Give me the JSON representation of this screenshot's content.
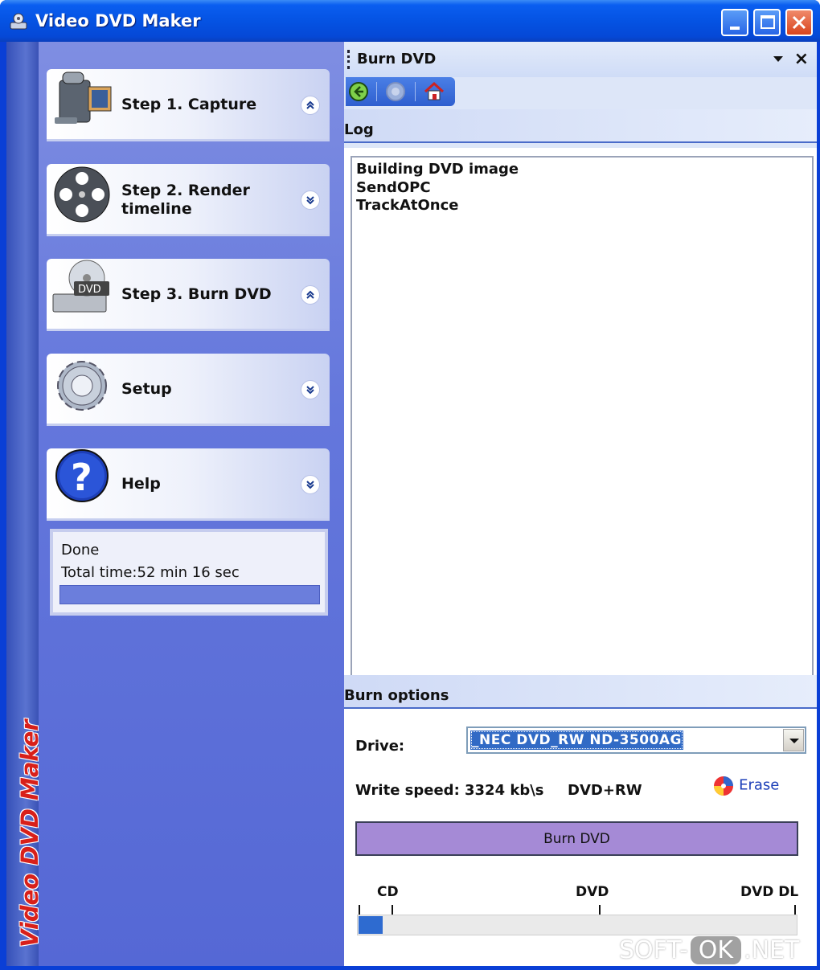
{
  "window": {
    "title": "Video DVD Maker",
    "brand_vertical": "Video DVD Maker"
  },
  "steps": [
    {
      "label": "Step 1. Capture",
      "icon": "camcorder-icon",
      "expanded": true
    },
    {
      "label": "Step 2. Render timeline",
      "icon": "film-reel-icon",
      "expanded": false
    },
    {
      "label": "Step 3. Burn DVD",
      "icon": "dvd-burner-icon",
      "expanded": true
    },
    {
      "label": "Setup",
      "icon": "gear-icon",
      "expanded": false
    },
    {
      "label": "Help",
      "icon": "help-icon",
      "expanded": false
    }
  ],
  "status": {
    "line1": "Done",
    "line2": "Total time:52 min 16 sec",
    "progress": 1.0
  },
  "panel": {
    "title": "Burn DVD",
    "toolbar": [
      "back-icon",
      "forward-icon",
      "home-icon"
    ]
  },
  "log": {
    "heading": "Log",
    "lines": [
      "Building DVD image",
      "SendOPC",
      "TrackAtOnce"
    ]
  },
  "burn_options": {
    "heading": "Burn options",
    "drive_label": "Drive:",
    "drive_value": "_NEC    DVD_RW ND-3500AG",
    "write_speed_label": "Write speed:",
    "write_speed_value": "3324 kb\\s",
    "media_type": "DVD+RW",
    "erase_label": "Erase",
    "burn_button": "Burn DVD",
    "capacity_labels": [
      "CD",
      "DVD",
      "DVD DL"
    ],
    "capacity_used_fraction": 0.055
  },
  "watermark": {
    "left": "SOFT-",
    "mid": "OK",
    "right": ".NET"
  },
  "colors": {
    "titlebar": "#0553e3",
    "left_panel": "#6477dc",
    "burn_button": "#a58ad6",
    "progress": "#2e6bd0",
    "brand_text": "#d8201a"
  }
}
